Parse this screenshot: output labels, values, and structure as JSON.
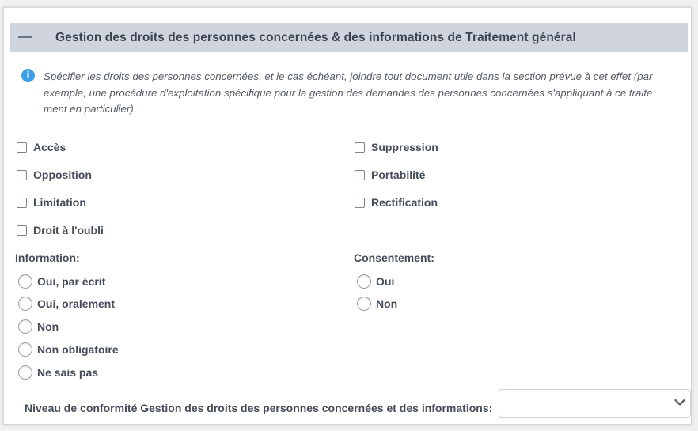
{
  "section": {
    "title": "Gestion des droits des personnes concernées & des informations de Traitement général"
  },
  "info": {
    "text": "Spécifier les droits des personnes concernées, et le cas échéant, joindre tout document utile dans la section prévue à cet effet (par exemple, une procédure d'exploitation spécifique pour la gestion des demandes des personnes concernées s'appliquant à ce traite ment en particulier)."
  },
  "rights": {
    "acces": "Accès",
    "suppression": "Suppression",
    "opposition": "Opposition",
    "portabilite": "Portabilité",
    "limitation": "Limitation",
    "rectification": "Rectification",
    "oubli": "Droit à l'oubli"
  },
  "information": {
    "label": "Information:",
    "options": [
      "Oui, par écrit",
      "Oui, oralement",
      "Non",
      "Non obligatoire",
      "Ne sais pas"
    ]
  },
  "consentement": {
    "label": "Consentement:",
    "options": [
      "Oui",
      "Non"
    ]
  },
  "compliance": {
    "label": "Niveau de conformité Gestion des droits des personnes concernées et des informations:",
    "value": ""
  }
}
